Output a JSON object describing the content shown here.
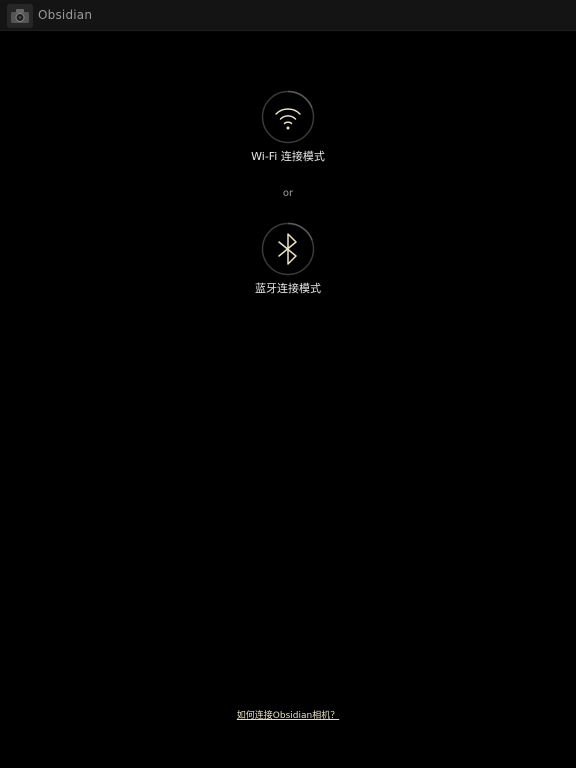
{
  "header": {
    "title": "Obsidian",
    "icon": "camera-app-icon"
  },
  "modes": {
    "wifi": {
      "label": "Wi-Fi 连接模式",
      "icon": "wifi-icon"
    },
    "separator": "or",
    "bluetooth": {
      "label": "蓝牙连接模式",
      "icon": "bluetooth-icon"
    }
  },
  "footer": {
    "help_link": "如何连接Obsidian相机？"
  },
  "colors": {
    "background": "#000000",
    "header_bg": "#141414",
    "accent": "#ede3c4",
    "ring": "#3a3a3a"
  }
}
